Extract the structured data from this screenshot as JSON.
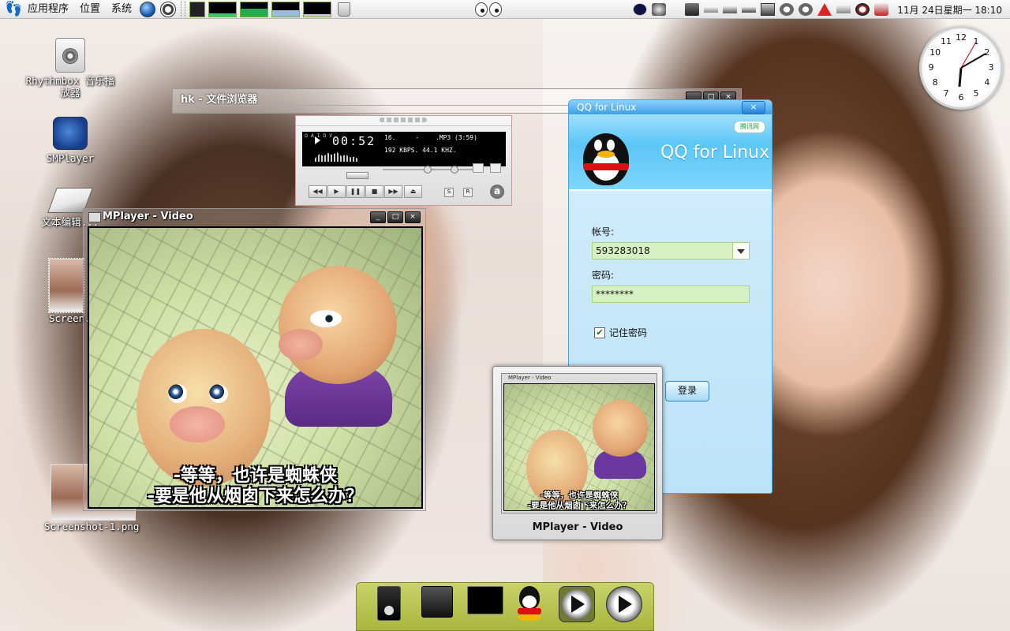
{
  "top_panel": {
    "menus": [
      "应用程序",
      "位置",
      "系统"
    ],
    "clock_text": "11月 24日星期一 18:10"
  },
  "desktop_icons": [
    {
      "label_line1": "Rhythmbox 音乐播",
      "label_line2": "放器"
    },
    {
      "label": "SMPlayer"
    },
    {
      "label": "文本编辑..."
    },
    {
      "label": "Screen..."
    },
    {
      "label": "Screenshot-1.png"
    }
  ],
  "file_browser": {
    "title": "hk - 文件浏览器"
  },
  "audio_player": {
    "side_letters": "O A I D V",
    "elapsed": "00:52",
    "track_num": "16.",
    "track_sep": "-",
    "format": ".MP3 (3:59)",
    "bitrate": "192 KBPS. 44.1 KHZ.",
    "buttons": {
      "prev": "◀◀",
      "play": "▶",
      "pause": "❚❚",
      "stop": "■",
      "next": "▶▶",
      "eject": "⏏",
      "shuffle": "S",
      "repeat": "R",
      "logo": "a"
    }
  },
  "mplayer": {
    "title": "MPlayer - Video",
    "subtitle_line1": "-等等，也许是蜘蛛侠",
    "subtitle_line2": "-要是他从烟囱下来怎么办？"
  },
  "qq_login": {
    "title": "QQ for Linux",
    "brand": "QQ for Linux",
    "tencent_badge": "腾讯网",
    "account_label": "帐号:",
    "account_value": "593283018",
    "password_label": "密码:",
    "password_value": "********",
    "remember_label": "记住密码",
    "remember_checked": true,
    "login_button": "登录"
  },
  "preview": {
    "mini_title": "MPlayer - Video",
    "caption": "MPlayer - Video",
    "subtitle_line1": "-等等，也许是蜘蛛侠",
    "subtitle_line2": "-要是他从烟囱下来怎么办？"
  },
  "analog_clock": {
    "numbers": [
      "12",
      "1",
      "2",
      "3",
      "4",
      "5",
      "6",
      "7",
      "8",
      "9",
      "10",
      "11"
    ],
    "hour": 6,
    "minute": 10,
    "second": 5
  },
  "window_buttons": {
    "minimize": "_",
    "maximize": "□",
    "close": "×"
  },
  "icons": {
    "foot": "gnome-foot-icon",
    "trash": "trash-icon"
  }
}
